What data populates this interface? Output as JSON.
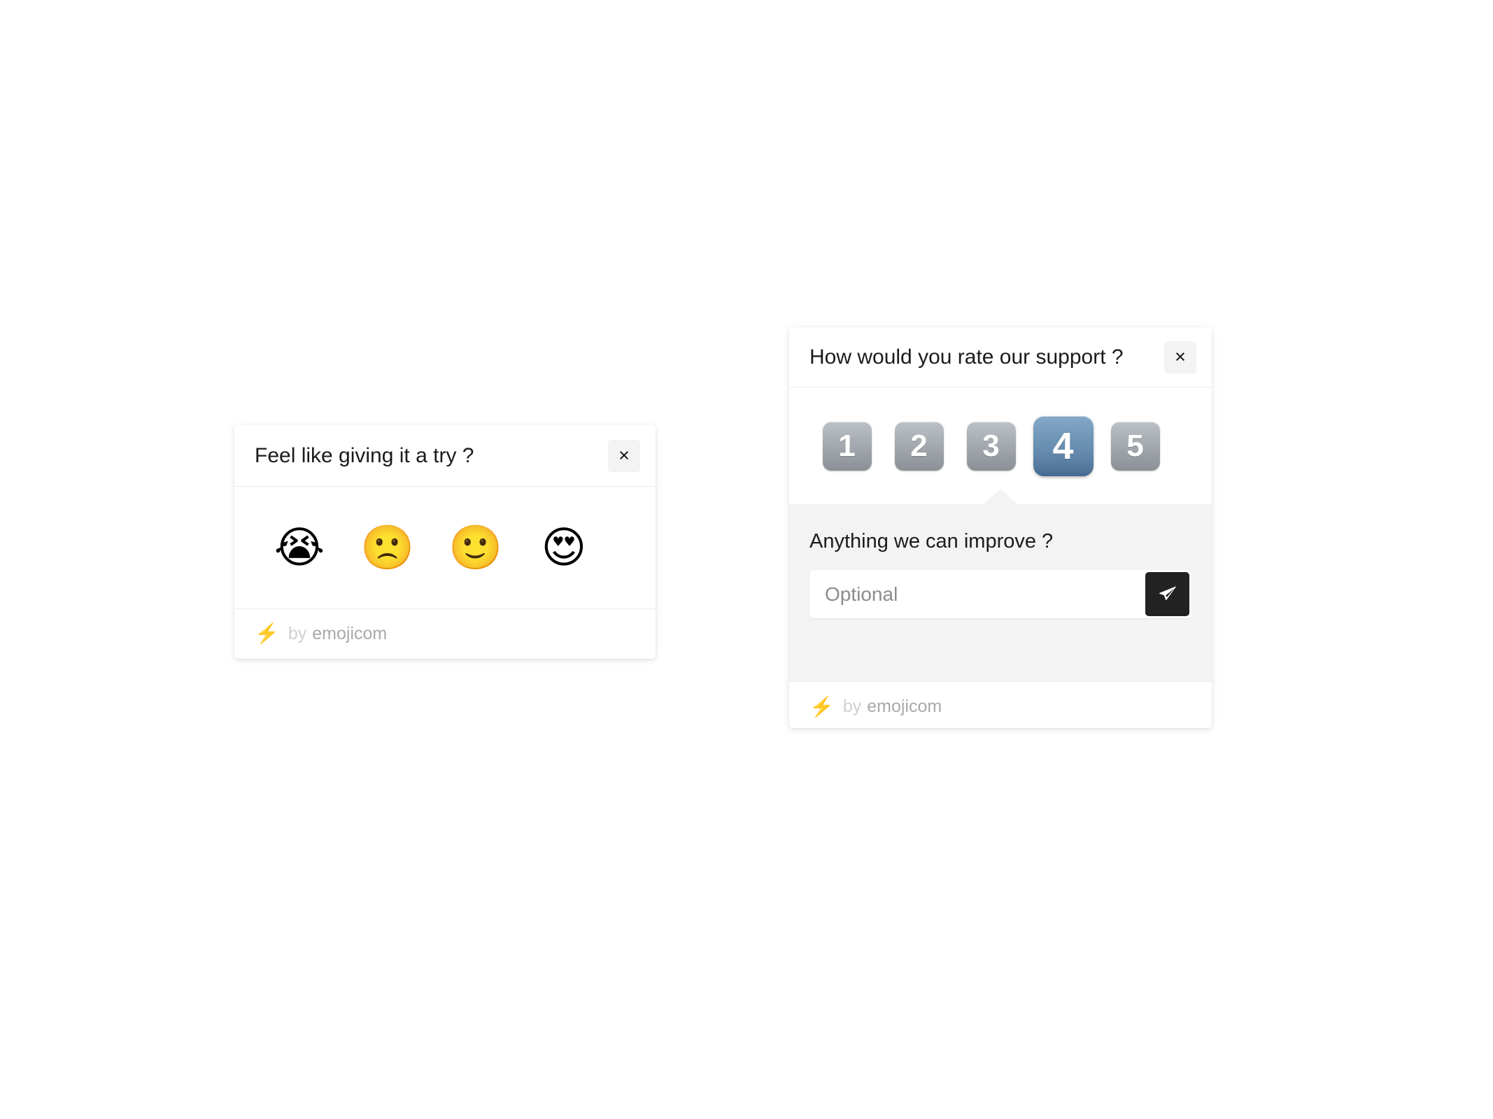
{
  "page": {
    "background_color": "#ffffff"
  },
  "emoji_widget": {
    "title": "Feel like giving it a try ?",
    "close_label": "×",
    "options": [
      {
        "name": "loudly-crying-face",
        "glyph": "😭",
        "value": 1
      },
      {
        "name": "slightly-frowning-face",
        "glyph": "🙁",
        "value": 2
      },
      {
        "name": "slightly-smiling-face",
        "glyph": "🙂",
        "value": 3
      },
      {
        "name": "smiling-face-with-heart-eyes",
        "glyph": "😍",
        "value": 4
      }
    ],
    "footer": {
      "bolt": "⚡",
      "by": "by",
      "brand": "emojicom"
    }
  },
  "rating_widget": {
    "title": "How would you rate our support ?",
    "close_label": "×",
    "scores": [
      {
        "label": "1",
        "selected": false
      },
      {
        "label": "2",
        "selected": false
      },
      {
        "label": "3",
        "selected": false
      },
      {
        "label": "4",
        "selected": true
      },
      {
        "label": "5",
        "selected": false
      }
    ],
    "selected_score": "4",
    "comment": {
      "label": "Anything we can improve ?",
      "value": "",
      "placeholder": "Optional",
      "send_icon": "send-icon"
    },
    "footer": {
      "bolt": "⚡",
      "by": "by",
      "brand": "emojicom"
    }
  },
  "colors": {
    "keycap_gray_light": "#bcc1c7",
    "keycap_gray_dark": "#8b9096",
    "keycap_selected_light": "#85a9c7",
    "keycap_selected_dark": "#476991",
    "panel_gray": "#f3f3f3",
    "send_button": "#222222",
    "bolt_yellow": "#f5b800",
    "brand_gray": "#a9a9a9"
  }
}
